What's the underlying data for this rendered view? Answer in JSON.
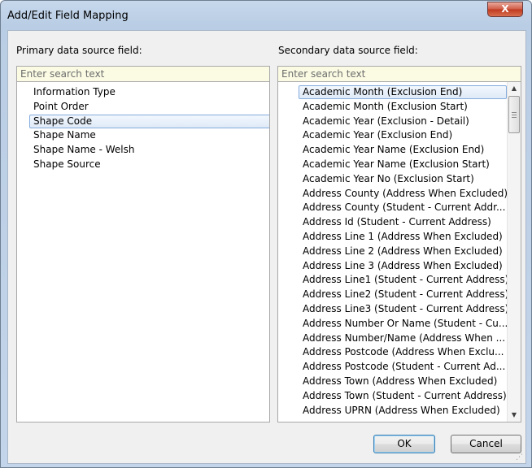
{
  "window": {
    "title": "Add/Edit Field Mapping",
    "close_label": "X"
  },
  "primary": {
    "label": "Primary data source field:",
    "search_placeholder": "Enter search text",
    "items": [
      "Information Type",
      "Point Order",
      "Shape Code",
      "Shape Name",
      "Shape Name - Welsh",
      "Shape Source"
    ],
    "selected_item": "Shape Code"
  },
  "secondary": {
    "label": "Secondary data source field:",
    "search_placeholder": "Enter search text",
    "items": [
      "Academic Month (Exclusion End)",
      "Academic Month (Exclusion Start)",
      "Academic Year (Exclusion - Detail)",
      "Academic Year (Exclusion End)",
      "Academic Year Name (Exclusion End)",
      "Academic Year Name (Exclusion Start)",
      "Academic Year No (Exclusion Start)",
      "Address County (Address When Excluded)",
      "Address County (Student - Current Addr...",
      "Address Id (Student - Current Address)",
      "Address Line 1 (Address When Excluded)",
      "Address Line 2 (Address When Excluded)",
      "Address Line 3 (Address When Excluded)",
      "Address Line1 (Student - Current Address)",
      "Address Line2 (Student - Current Address)",
      "Address Line3 (Student - Current Address)",
      "Address Number Or Name (Student - Cu...",
      "Address Number/Name (Address When ...",
      "Address Postcode (Address When Exclu...",
      "Address Postcode (Student - Current Ad...",
      "Address Town (Address When Excluded)",
      "Address Town (Student - Current Address)",
      "Address UPRN (Address When Excluded)"
    ],
    "selected_item": "Academic Month (Exclusion End)"
  },
  "buttons": {
    "ok": "OK",
    "cancel": "Cancel"
  },
  "icons": {
    "scroll_up": "up-arrow-icon",
    "scroll_down": "down-arrow-icon",
    "resize": "resize-grip-icon"
  }
}
